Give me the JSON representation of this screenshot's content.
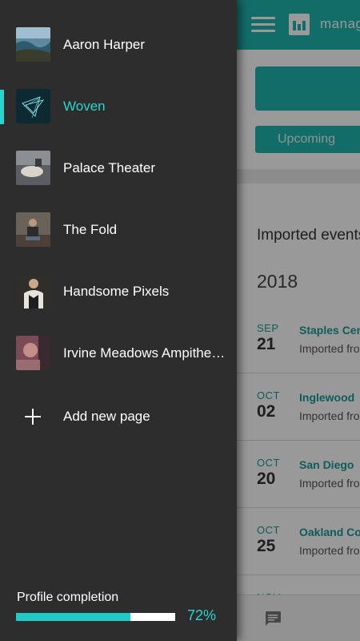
{
  "app": {
    "brand_text": "manage",
    "upcoming_tab": "Upcoming",
    "imported_heading": "Imported events",
    "year": "2018",
    "events": [
      {
        "month": "SEP",
        "day": "21",
        "title": "Staples Center",
        "subtitle": "Imported from"
      },
      {
        "month": "OCT",
        "day": "02",
        "title": "Inglewood",
        "subtitle": "Imported from"
      },
      {
        "month": "OCT",
        "day": "20",
        "title": "San Diego",
        "subtitle": "Imported from"
      },
      {
        "month": "OCT",
        "day": "25",
        "title": "Oakland Coliseum",
        "subtitle": "Imported from"
      },
      {
        "month": "NOV",
        "day": "",
        "title": "",
        "subtitle": ""
      }
    ]
  },
  "drawer": {
    "pages": [
      {
        "label": "Aaron Harper",
        "active": false
      },
      {
        "label": "Woven",
        "active": true
      },
      {
        "label": "Palace Theater",
        "active": false
      },
      {
        "label": "The Fold",
        "active": false
      },
      {
        "label": "Handsome Pixels",
        "active": false
      },
      {
        "label": "Irvine Meadows Ampitheater",
        "active": false
      }
    ],
    "add_page_label": "Add new page",
    "profile_completion_label": "Profile completion",
    "profile_completion_value": 0.72,
    "profile_completion_text": "72%"
  },
  "colors": {
    "accent": "#2ad4cf",
    "brand": "#1fb4ae",
    "drawer_bg": "#2d2d2d"
  }
}
